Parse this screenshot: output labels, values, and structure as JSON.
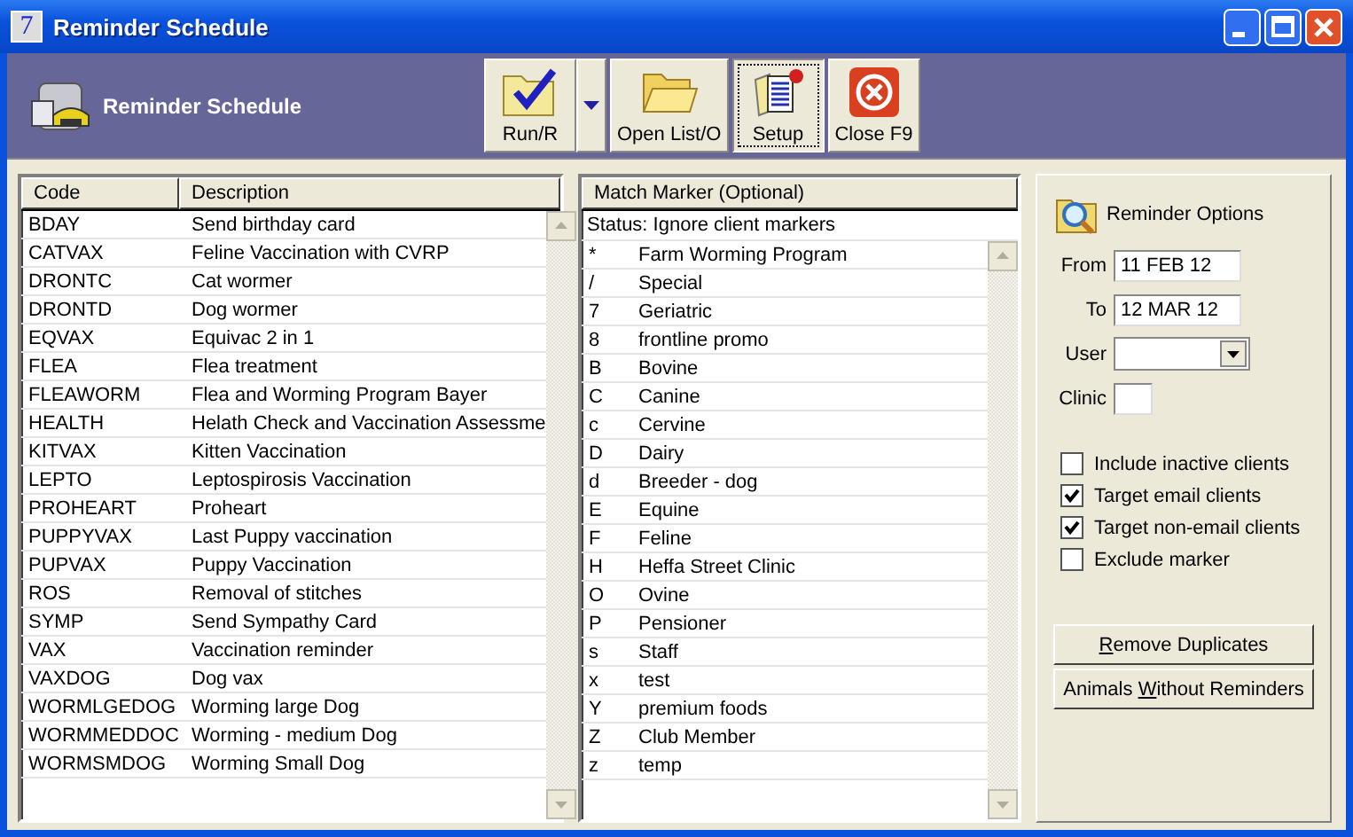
{
  "window": {
    "title": "Reminder Schedule",
    "app_icon_label": "7"
  },
  "header": {
    "title": "Reminder Schedule"
  },
  "toolbar": [
    {
      "kind": "run",
      "label": "Run/R",
      "selected": false,
      "has_dropdown": true
    },
    {
      "kind": "open",
      "label": "Open List/O",
      "selected": false,
      "has_dropdown": false
    },
    {
      "kind": "setup",
      "label": "Setup",
      "selected": true,
      "has_dropdown": false
    },
    {
      "kind": "close",
      "label": "Close F9",
      "selected": false,
      "has_dropdown": false
    }
  ],
  "codes_table": {
    "columns": [
      "Code",
      "Description"
    ],
    "rows": [
      {
        "code": "BDAY",
        "description": "Send birthday card"
      },
      {
        "code": "CATVAX",
        "description": "Feline Vaccination with CVRP"
      },
      {
        "code": "DRONTC",
        "description": "Cat wormer"
      },
      {
        "code": "DRONTD",
        "description": "Dog wormer"
      },
      {
        "code": "EQVAX",
        "description": "Equivac 2 in 1"
      },
      {
        "code": "FLEA",
        "description": "Flea treatment"
      },
      {
        "code": "FLEAWORM",
        "description": "Flea and Worming Program Bayer"
      },
      {
        "code": "HEALTH",
        "description": "Helath Check and Vaccination Assessme"
      },
      {
        "code": "KITVAX",
        "description": "Kitten Vaccination"
      },
      {
        "code": "LEPTO",
        "description": "Leptospirosis Vaccination"
      },
      {
        "code": "PROHEART",
        "description": "Proheart"
      },
      {
        "code": "PUPPYVAX",
        "description": "Last Puppy vaccination"
      },
      {
        "code": "PUPVAX",
        "description": "Puppy Vaccination"
      },
      {
        "code": "ROS",
        "description": "Removal of stitches"
      },
      {
        "code": "SYMP",
        "description": "Send Sympathy Card"
      },
      {
        "code": "VAX",
        "description": "Vaccination reminder"
      },
      {
        "code": "VAXDOG",
        "description": "Dog vax"
      },
      {
        "code": "WORMLGEDOG",
        "description": "Worming large Dog"
      },
      {
        "code": "WORMMEDDOC",
        "description": "Worming  - medium Dog"
      },
      {
        "code": "WORMSMDOG",
        "description": "Worming Small Dog"
      }
    ]
  },
  "marker_table": {
    "title": "Match Marker (Optional)",
    "status": "Status: Ignore client markers",
    "rows": [
      {
        "marker": "*",
        "name": "Farm Worming Program"
      },
      {
        "marker": "/",
        "name": "Special"
      },
      {
        "marker": "7",
        "name": "Geriatric"
      },
      {
        "marker": "8",
        "name": "frontline promo"
      },
      {
        "marker": "B",
        "name": "Bovine"
      },
      {
        "marker": "C",
        "name": "Canine"
      },
      {
        "marker": "c",
        "name": "Cervine"
      },
      {
        "marker": "D",
        "name": "Dairy"
      },
      {
        "marker": "d",
        "name": "Breeder - dog"
      },
      {
        "marker": "E",
        "name": "Equine"
      },
      {
        "marker": "F",
        "name": "Feline"
      },
      {
        "marker": "H",
        "name": "Heffa Street Clinic"
      },
      {
        "marker": "O",
        "name": "Ovine"
      },
      {
        "marker": "P",
        "name": "Pensioner"
      },
      {
        "marker": "s",
        "name": "Staff"
      },
      {
        "marker": "x",
        "name": "test"
      },
      {
        "marker": "Y",
        "name": "premium foods"
      },
      {
        "marker": "Z",
        "name": "Club Member"
      },
      {
        "marker": "z",
        "name": "temp"
      }
    ]
  },
  "options": {
    "title": "Reminder Options",
    "fields": [
      {
        "kind": "text",
        "label": "From",
        "value": "11 FEB 12"
      },
      {
        "kind": "text",
        "label": "To",
        "value": "12 MAR 12"
      },
      {
        "kind": "dropdown",
        "label": "User"
      },
      {
        "kind": "small",
        "label": "Clinic"
      }
    ],
    "checkboxes": [
      {
        "label": "Include inactive clients",
        "checked": false
      },
      {
        "label": "Target email clients",
        "checked": true
      },
      {
        "label": "Target non-email clients",
        "checked": true
      },
      {
        "label": "Exclude marker",
        "checked": false
      }
    ],
    "buttons": [
      {
        "access_key": "R",
        "after": "emove Duplicates"
      },
      {
        "before": "Animals ",
        "access_key": "W",
        "after": "ithout Reminders"
      }
    ]
  }
}
